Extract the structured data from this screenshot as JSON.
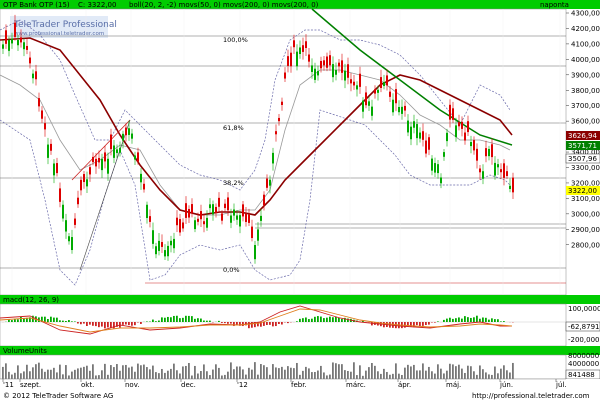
{
  "main_panel": {
    "title": "OTP Bank OTP (15)",
    "last_value": "C: 3322,00",
    "indicators": "boll(20, 2, -2) movs(50, 0) movs(200, 0) movs(200, 0)",
    "period_label": "naponta",
    "watermark_title": "TeleTrader Professional",
    "watermark_url": "www.professional.teletrader.com",
    "fib_labels": [
      "100,0%",
      "61,8%",
      "38,2%",
      "0,0%"
    ],
    "y_ticks": [
      "4300,00",
      "4200,00",
      "4100,00",
      "4000,00",
      "3900,00",
      "3800,00",
      "3700,00",
      "3600,00",
      "3500,00",
      "3400,00",
      "3300,00",
      "3200,00",
      "3100,00",
      "3000,00",
      "2900,00",
      "2800,00"
    ],
    "price_tags": [
      {
        "text": "3626,94",
        "color": "#8b0000"
      },
      {
        "text": "3571,71",
        "color": "#008000"
      },
      {
        "text": "3507,96",
        "color": "#ffffff"
      },
      {
        "text": "3322,00",
        "color": "#ffff00"
      }
    ]
  },
  "macd_panel": {
    "title": "macd(12, 26, 9)",
    "y_ticks": [
      "100,0000",
      "-62,8791",
      "-200,0000"
    ],
    "tag": "-62,8791"
  },
  "volume_panel": {
    "title": "VolumeUnits",
    "y_ticks": [
      "8000000",
      "4000000",
      "841488"
    ],
    "tag": "841488"
  },
  "x_axis": {
    "labels": [
      "'11",
      "szept.",
      "okt.",
      "nov.",
      "dec.",
      "'12",
      "febr.",
      "márc.",
      "ápr.",
      "máj.",
      "jún.",
      "júl."
    ]
  },
  "footer": {
    "copyright": "© 2012 TeleTrader Software AG",
    "url": "http://professional.teletrader.com"
  },
  "colors": {
    "up_candle": "#00aa00",
    "down_candle": "#dd0000",
    "ma50": "#8b0000",
    "trend": "#008000",
    "bollinger": "#6a6aaa",
    "header_green": "#00cc00"
  }
}
